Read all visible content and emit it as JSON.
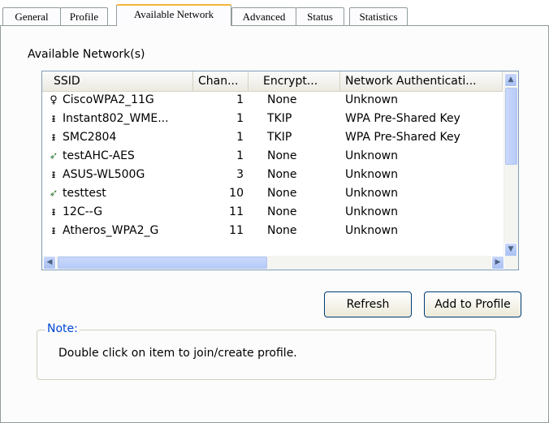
{
  "tabs": [
    {
      "label": "General"
    },
    {
      "label": "Profile"
    },
    {
      "label": "Available Network",
      "active": true
    },
    {
      "label": "Advanced"
    },
    {
      "label": "Status"
    },
    {
      "label": "Statistics"
    }
  ],
  "section_label": "Available Network(s)",
  "columns": [
    "SSID",
    "Chan...",
    "Encrypt...",
    "Network Authenticati..."
  ],
  "networks": [
    {
      "icon": "antenna-icon",
      "ssid": "CiscoWPA2_11G",
      "channel": "1",
      "encryption": "None",
      "auth": "Unknown"
    },
    {
      "icon": "access-point-icon",
      "ssid": "Instant802_WME...",
      "channel": "1",
      "encryption": "TKIP",
      "auth": "WPA Pre-Shared Key"
    },
    {
      "icon": "access-point-icon",
      "ssid": "SMC2804",
      "channel": "1",
      "encryption": "TKIP",
      "auth": "WPA Pre-Shared Key"
    },
    {
      "icon": "adhoc-icon",
      "ssid": "testAHC-AES",
      "channel": "1",
      "encryption": "None",
      "auth": "Unknown"
    },
    {
      "icon": "access-point-icon",
      "ssid": "ASUS-WL500G",
      "channel": "3",
      "encryption": "None",
      "auth": "Unknown"
    },
    {
      "icon": "adhoc-icon",
      "ssid": "testtest",
      "channel": "10",
      "encryption": "None",
      "auth": "Unknown"
    },
    {
      "icon": "access-point-icon",
      "ssid": "12C--G",
      "channel": "11",
      "encryption": "None",
      "auth": "Unknown"
    },
    {
      "icon": "access-point-icon",
      "ssid": "Atheros_WPA2_G",
      "channel": "11",
      "encryption": "None",
      "auth": "Unknown"
    }
  ],
  "buttons": {
    "refresh": "Refresh",
    "add_to_profile": "Add to Profile"
  },
  "note": {
    "title": "Note:",
    "text": "Double click on item to join/create profile."
  },
  "colors": {
    "active_tab_accent": "#f6b33b",
    "note_title": "#0046d5",
    "scroll_thumb": "#c9d8fc"
  }
}
